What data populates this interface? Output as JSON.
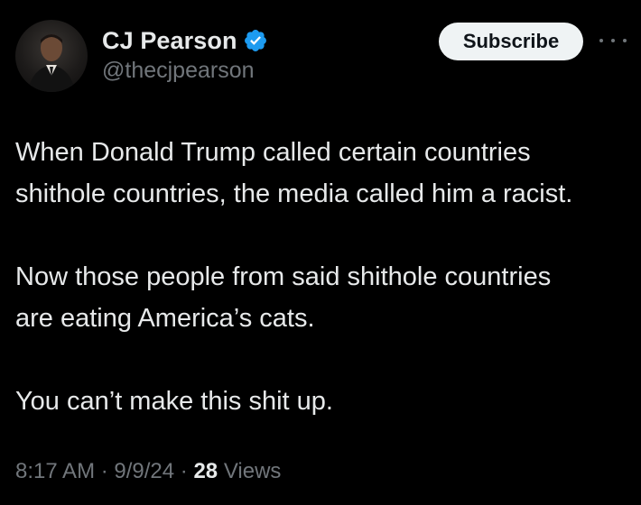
{
  "author": {
    "display_name": "CJ Pearson",
    "handle": "@thecjpearson",
    "verified": true,
    "verified_color": "#1d9bf0"
  },
  "actions": {
    "subscribe_label": "Subscribe",
    "more_icon": "more-horizontal-icon"
  },
  "tweet": {
    "lines": [
      "When Donald Trump called certain countries",
      "shithole countries, the media called him a racist.",
      "Now those people from said shithole countries",
      "are eating America’s cats.",
      "You can’t make this shit up."
    ]
  },
  "meta": {
    "time": "8:17 AM",
    "separator": " · ",
    "date": "9/9/24",
    "views_count": "28",
    "views_label": " Views"
  },
  "colors": {
    "background": "#000000",
    "primary_text": "#e7e9ea",
    "secondary_text": "#71767b",
    "button_bg": "#eff3f4"
  }
}
